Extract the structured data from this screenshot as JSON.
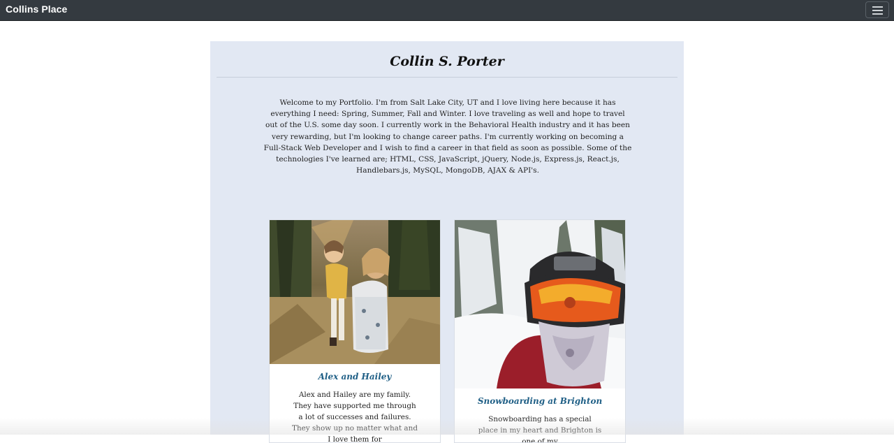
{
  "navbar": {
    "brand": "Collins Place",
    "toggle_icon": "hamburger-menu-icon"
  },
  "header": {
    "title": "Collin S. Porter"
  },
  "intro": {
    "text": "Welcome to my Portfolio. I'm from Salt Lake City, UT and I love living here because it has everything I need: Spring, Summer, Fall and Winter. I love traveling as well and hope to travel out of the U.S. some day soon. I currently work in the Behavioral Health industry and it has been very rewarding, but I'm looking to change career paths. I'm currently working on becoming a Full-Stack Web Developer and I wish to find a career in that field as soon as possible. Some of the technologies I've learned are; HTML, CSS, JavaScript, jQuery, Node.js, Express.js, React.js, Handlebars.js, MySQL, MongoDB, AJAX & API's."
  },
  "cards": [
    {
      "title": "Alex and Hailey",
      "text": "Alex and Hailey are my family. They have supported me through a lot of successes and failures. They show up no matter what and I love them for"
    },
    {
      "title": "Snowboarding at Brighton",
      "text": "Snowboarding has a special place in my heart and Brighton is one of my"
    }
  ],
  "colors": {
    "navbar_bg": "#343a40",
    "panel_bg": "#e2e8f3",
    "card_title": "#1f5f86"
  }
}
